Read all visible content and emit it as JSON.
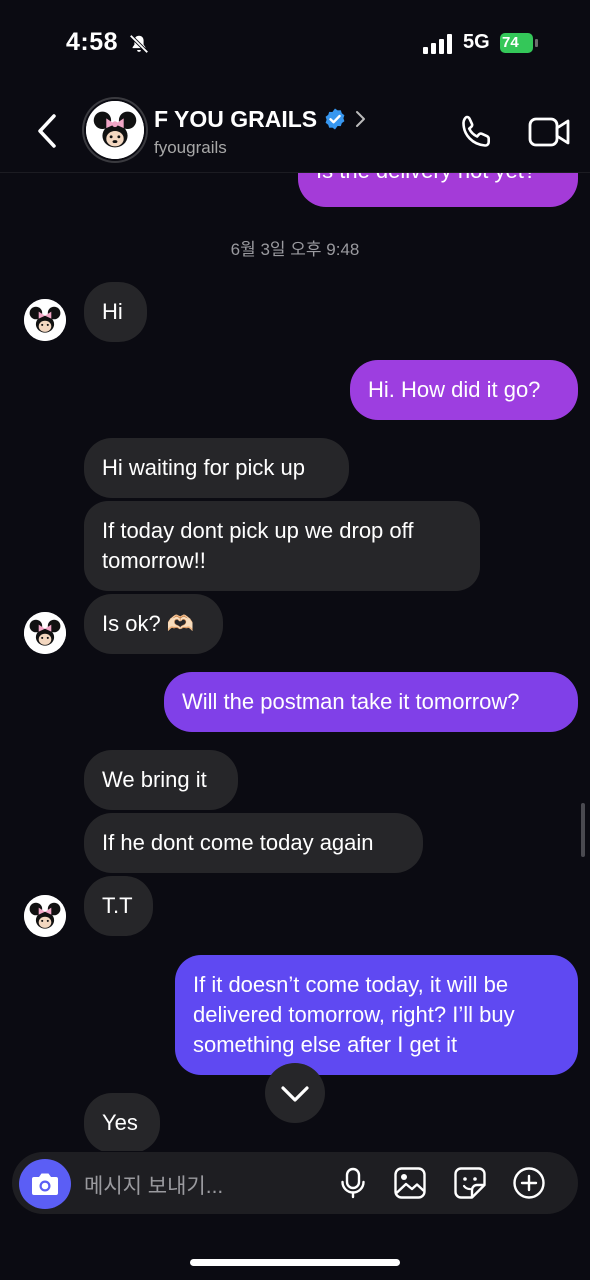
{
  "status": {
    "time": "4:58",
    "network": "5G",
    "battery": "74"
  },
  "header": {
    "title": "F YOU GRAILS",
    "handle": "fyougrails"
  },
  "timestamp": "6월 3일 오후 9:48",
  "messages": [
    {
      "dir": "out",
      "text": "Is the delivery not yet?"
    },
    {
      "dir": "in",
      "text": "Hi"
    },
    {
      "dir": "out",
      "text": "Hi. How did it go?"
    },
    {
      "dir": "in",
      "text": "Hi waiting for pick up"
    },
    {
      "dir": "in",
      "text": "If today dont pick up we drop off tomorrow!!"
    },
    {
      "dir": "in",
      "text": "Is ok? 🫶🏻"
    },
    {
      "dir": "out",
      "text": "Will the postman take it tomorrow?"
    },
    {
      "dir": "in",
      "text": "We bring it"
    },
    {
      "dir": "in",
      "text": "If he dont come today again"
    },
    {
      "dir": "in",
      "text": "T.T"
    },
    {
      "dir": "out",
      "text": "If it doesn’t come today, it will be delivered tomorrow, right? I’ll buy something else after I get it"
    },
    {
      "dir": "in",
      "text": "Yes"
    }
  ],
  "composer": {
    "placeholder": "메시지 보내기..."
  },
  "colors": {
    "outgoing_top": "#a43bd8",
    "outgoing_bottom": "#5f49f2",
    "incoming": "#262629",
    "camera": "#5b5ef5",
    "verified": "#3797f0"
  }
}
